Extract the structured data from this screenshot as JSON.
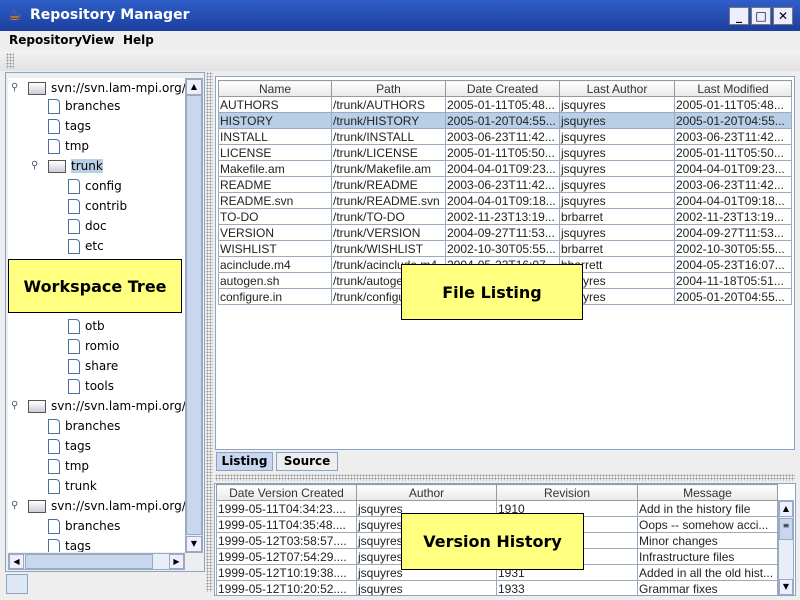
{
  "window": {
    "title": "Repository Manager",
    "minimize": "_",
    "maximize": "□",
    "close": "✕"
  },
  "menu": [
    "Repository",
    "View",
    "Help"
  ],
  "tree": {
    "items": [
      {
        "i": 0,
        "level": 0,
        "type": "folder",
        "label": "svn://svn.lam-mpi.org/trill",
        "expander": true
      },
      {
        "i": 1,
        "level": 1,
        "type": "file",
        "label": "branches"
      },
      {
        "i": 2,
        "level": 1,
        "type": "file",
        "label": "tags"
      },
      {
        "i": 3,
        "level": 1,
        "type": "file",
        "label": "tmp"
      },
      {
        "i": 4,
        "level": 1,
        "type": "folder",
        "label": "trunk",
        "expander": true,
        "selected": true
      },
      {
        "i": 5,
        "level": 2,
        "type": "file",
        "label": "config"
      },
      {
        "i": 6,
        "level": 2,
        "type": "file",
        "label": "contrib"
      },
      {
        "i": 7,
        "level": 2,
        "type": "file",
        "label": "doc"
      },
      {
        "i": 8,
        "level": 2,
        "type": "file",
        "label": "etc"
      },
      {
        "i": 12,
        "level": 2,
        "type": "file",
        "label": "otb"
      },
      {
        "i": 13,
        "level": 2,
        "type": "file",
        "label": "romio"
      },
      {
        "i": 14,
        "level": 2,
        "type": "file",
        "label": "share"
      },
      {
        "i": 15,
        "level": 2,
        "type": "file",
        "label": "tools"
      },
      {
        "i": 16,
        "level": 0,
        "type": "folder",
        "label": "svn://svn.lam-mpi.org/trill",
        "expander": true
      },
      {
        "i": 17,
        "level": 1,
        "type": "file",
        "label": "branches"
      },
      {
        "i": 18,
        "level": 1,
        "type": "file",
        "label": "tags"
      },
      {
        "i": 19,
        "level": 1,
        "type": "file",
        "label": "tmp"
      },
      {
        "i": 20,
        "level": 1,
        "type": "file",
        "label": "trunk"
      },
      {
        "i": 21,
        "level": 0,
        "type": "folder",
        "label": "svn://svn.lam-mpi.org/trill",
        "expander": true
      },
      {
        "i": 22,
        "level": 1,
        "type": "file",
        "label": "branches"
      },
      {
        "i": 23,
        "level": 1,
        "type": "file",
        "label": "tags"
      }
    ]
  },
  "listing": {
    "columns": [
      "Name",
      "Path",
      "Date Created",
      "Last Author",
      "Last Modified"
    ],
    "selected_row": 1,
    "rows": [
      [
        "AUTHORS",
        "/trunk/AUTHORS",
        "2005-01-11T05:48...",
        "jsquyres",
        "2005-01-11T05:48..."
      ],
      [
        "HISTORY",
        "/trunk/HISTORY",
        "2005-01-20T04:55...",
        "jsquyres",
        "2005-01-20T04:55..."
      ],
      [
        "INSTALL",
        "/trunk/INSTALL",
        "2003-06-23T11:42...",
        "jsquyres",
        "2003-06-23T11:42..."
      ],
      [
        "LICENSE",
        "/trunk/LICENSE",
        "2005-01-11T05:50...",
        "jsquyres",
        "2005-01-11T05:50..."
      ],
      [
        "Makefile.am",
        "/trunk/Makefile.am",
        "2004-04-01T09:23...",
        "jsquyres",
        "2004-04-01T09:23..."
      ],
      [
        "README",
        "/trunk/README",
        "2003-06-23T11:42...",
        "jsquyres",
        "2003-06-23T11:42..."
      ],
      [
        "README.svn",
        "/trunk/README.svn",
        "2004-04-01T09:18...",
        "jsquyres",
        "2004-04-01T09:18..."
      ],
      [
        "TO-DO",
        "/trunk/TO-DO",
        "2002-11-23T13:19...",
        "brbarret",
        "2002-11-23T13:19..."
      ],
      [
        "VERSION",
        "/trunk/VERSION",
        "2004-09-27T11:53...",
        "jsquyres",
        "2004-09-27T11:53..."
      ],
      [
        "WISHLIST",
        "/trunk/WISHLIST",
        "2002-10-30T05:55...",
        "brbarret",
        "2002-10-30T05:55..."
      ],
      [
        "acinclude.m4",
        "/trunk/acinclude.m4",
        "2004-05-23T16:07...",
        "bbarrett",
        "2004-05-23T16:07..."
      ],
      [
        "autogen.sh",
        "/trunk/autogen.sh",
        "",
        "jsquyres",
        "2004-11-18T05:51..."
      ],
      [
        "configure.in",
        "/trunk/configure.in",
        "",
        "jsquyres",
        "2005-01-20T04:55..."
      ]
    ]
  },
  "tabs": [
    "Listing",
    "Source"
  ],
  "history": {
    "columns": [
      "Date Version Created",
      "Author",
      "Revision",
      "Message"
    ],
    "rows": [
      [
        "1999-05-11T04:34:23....",
        "jsquyres",
        "1910",
        "Add in the history file"
      ],
      [
        "1999-05-11T04:35:48....",
        "jsquyres",
        "",
        "Oops -- somehow acci..."
      ],
      [
        "1999-05-12T03:58:57....",
        "jsquyres",
        "",
        "Minor changes"
      ],
      [
        "1999-05-12T07:54:29....",
        "jsquyres",
        "",
        "Infrastructure files"
      ],
      [
        "1999-05-12T10:19:38....",
        "jsquyres",
        "1931",
        "Added in all the old hist..."
      ],
      [
        "1999-05-12T10:20:52....",
        "jsquyres",
        "1933",
        "Grammar fixes"
      ]
    ]
  },
  "callouts": {
    "tree": "Workspace Tree",
    "listing": "File Listing",
    "history": "Version History"
  }
}
